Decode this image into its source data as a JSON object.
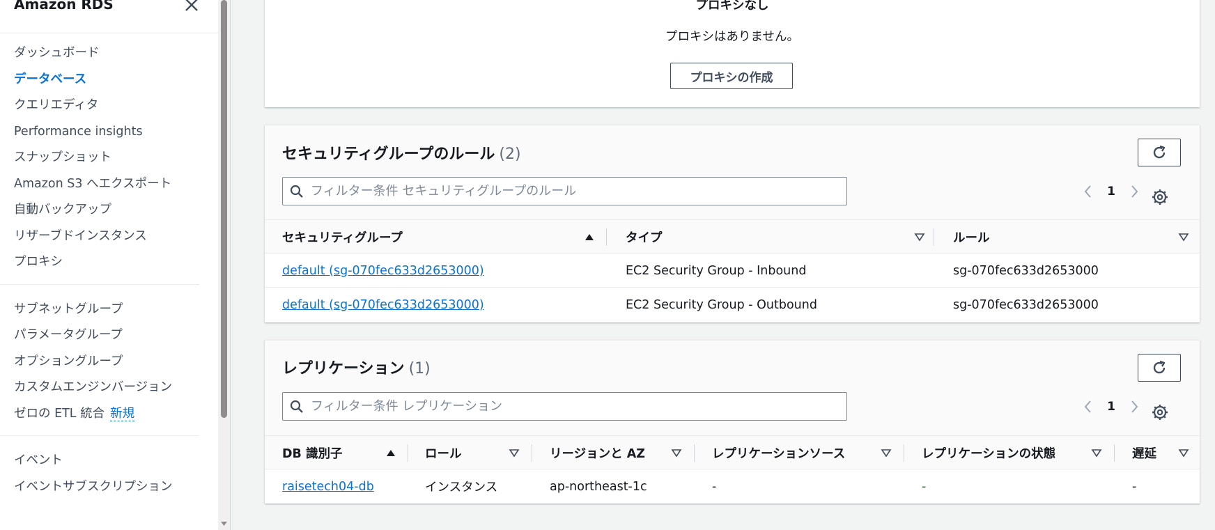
{
  "sidebar": {
    "title": "Amazon RDS",
    "sections": [
      [
        {
          "label": "ダッシュボード",
          "active": false
        },
        {
          "label": "データベース",
          "active": true
        },
        {
          "label": "クエリエディタ",
          "active": false
        },
        {
          "label": "Performance insights",
          "active": false
        },
        {
          "label": "スナップショット",
          "active": false
        },
        {
          "label": "Amazon S3 へエクスポート",
          "active": false
        },
        {
          "label": "自動バックアップ",
          "active": false
        },
        {
          "label": "リザーブドインスタンス",
          "active": false
        },
        {
          "label": "プロキシ",
          "active": false
        }
      ],
      [
        {
          "label": "サブネットグループ"
        },
        {
          "label": "パラメータグループ"
        },
        {
          "label": "オプショングループ"
        },
        {
          "label": "カスタムエンジンバージョン"
        },
        {
          "label": "ゼロの ETL 統合",
          "badge": "新規"
        }
      ],
      [
        {
          "label": "イベント"
        },
        {
          "label": "イベントサブスクリプション"
        }
      ]
    ]
  },
  "proxy": {
    "heading": "プロキシなし",
    "message": "プロキシはありません。",
    "create_button": "プロキシの作成"
  },
  "security": {
    "title": "セキュリティグループのルール",
    "count": "(2)",
    "filter_placeholder": "フィルター条件 セキュリティグループのルール",
    "page": "1",
    "columns": [
      "セキュリティグループ",
      "タイプ",
      "ルール"
    ],
    "rows": [
      {
        "group": "default (sg-070fec633d2653000)",
        "type": "EC2 Security Group - Inbound",
        "rule": "sg-070fec633d2653000"
      },
      {
        "group": "default (sg-070fec633d2653000)",
        "type": "EC2 Security Group - Outbound",
        "rule": "sg-070fec633d2653000"
      }
    ]
  },
  "replication": {
    "title": "レプリケーション",
    "count": "(1)",
    "filter_placeholder": "フィルター条件 レプリケーション",
    "page": "1",
    "columns": [
      "DB 識別子",
      "ロール",
      "リージョンと AZ",
      "レプリケーションソース",
      "レプリケーションの状態",
      "遅延"
    ],
    "rows": [
      {
        "db": "raisetech04-db",
        "role": "インスタンス",
        "region": "ap-northeast-1c",
        "source": "-",
        "state": "-",
        "lag": "-"
      }
    ]
  },
  "colors": {
    "link": "#0972d3",
    "status_green": "#037f0c",
    "text": "#16191f",
    "muted": "#414d5c"
  }
}
